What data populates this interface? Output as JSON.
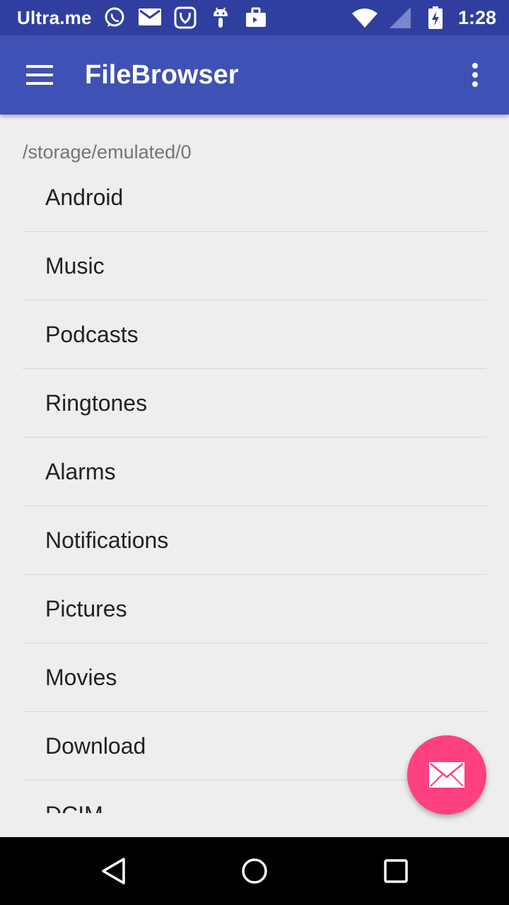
{
  "status_bar": {
    "carrier": "Ultra.me",
    "time": "1:28",
    "notification_icons": [
      "whatsapp-icon",
      "mail-icon",
      "saavn-icon",
      "android-debug-icon",
      "briefcase-icon"
    ],
    "system_icons": [
      "wifi-icon",
      "signal-icon",
      "battery-charging-icon"
    ]
  },
  "app_bar": {
    "title": "FileBrowser",
    "menu_icon": "hamburger-menu-icon",
    "overflow_icon": "more-vert-icon",
    "color": "#3f51b5"
  },
  "content": {
    "path": "/storage/emulated/0",
    "items": [
      {
        "label": "Android"
      },
      {
        "label": "Music"
      },
      {
        "label": "Podcasts"
      },
      {
        "label": "Ringtones"
      },
      {
        "label": "Alarms"
      },
      {
        "label": "Notifications"
      },
      {
        "label": "Pictures"
      },
      {
        "label": "Movies"
      },
      {
        "label": "Download"
      },
      {
        "label": "DCIM"
      }
    ]
  },
  "fab": {
    "icon": "mail-icon",
    "color": "#ff4081"
  },
  "nav_bar": {
    "buttons": [
      "back-icon",
      "home-icon",
      "recents-icon"
    ]
  }
}
